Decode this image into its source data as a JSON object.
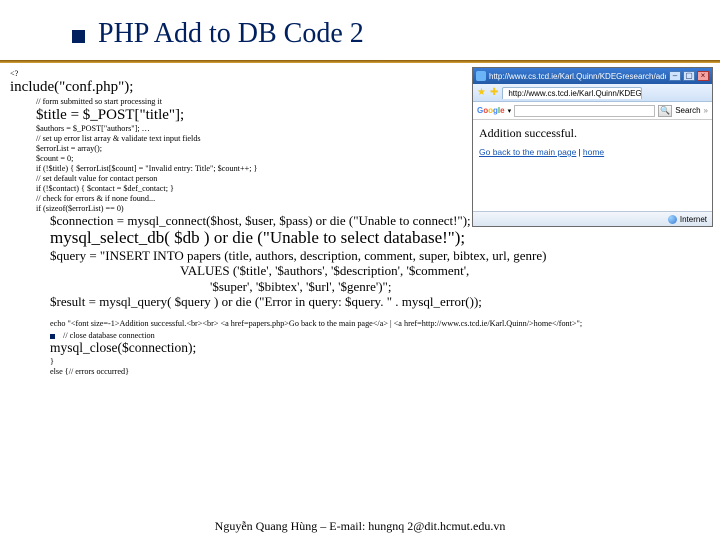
{
  "slide": {
    "title": "PHP Add to DB Code 2"
  },
  "code": {
    "l01": "<?",
    "l02": "include(\"conf.php\");",
    "l03": "// form submitted so start processing it",
    "l04": "$title = $_POST[\"title\"];",
    "l05": "$authors = $_POST[\"authors\"]; …",
    "l06": "// set up error list array & validate text input fields",
    "l07": "$errorList = array();",
    "l08": "$count = 0;",
    "l09": "if (!$title) { $errorList[$count] = \"Invalid entry: Title\"; $count++; }",
    "l10": "// set default value for contact person",
    "l11": "if (!$contact) { $contact = $def_contact; }",
    "l12": "// check for errors & if none found...",
    "l13": "if (sizeof($errorList) == 0)",
    "l14": "$connection = mysql_connect($host, $user, $pass) or die (\"Unable to connect!\");",
    "l15": "mysql_select_db( $db ) or die (\"Unable to select database!\");",
    "l16": "$query = \"INSERT INTO papers (title, authors, description, comment, super, bibtex, url, genre)",
    "l17": "VALUES ('$title', '$authors', '$description', '$comment',",
    "l18": "'$super', '$bibtex', '$url', '$genre')\";",
    "l19": "$result = mysql_query( $query ) or die (\"Error in query: $query. \" . mysql_error());",
    "l20": "echo \"<font size=-1>Addition successful.<br><br> <a href=papers.php>Go back to the main page</a> | <a href=http://www.cs.tcd.ie/Karl.Quinn/>home</font>\";",
    "l21": "// close database connection",
    "l22": "mysql_close($connection);",
    "l23": "}",
    "l24": "else {// errors occurred}"
  },
  "browser": {
    "url_top": "http://www.cs.tcd.ie/Karl.Quinn/KDEGresearch/addUpdate.php ...",
    "tab_label": "http://www.cs.tcd.ie/Karl.Quinn/KDEGresearch/addUpdate...",
    "google_search_btn": "Search",
    "content_heading": "Addition successful.",
    "content_link": "Go back to the main page",
    "content_sep": " | ",
    "content_home": "home",
    "status_zone": "Internet"
  },
  "footer": {
    "text": "Nguyễn Quang Hùng – E-mail: hungnq 2@dit.hcmut.edu.vn"
  }
}
